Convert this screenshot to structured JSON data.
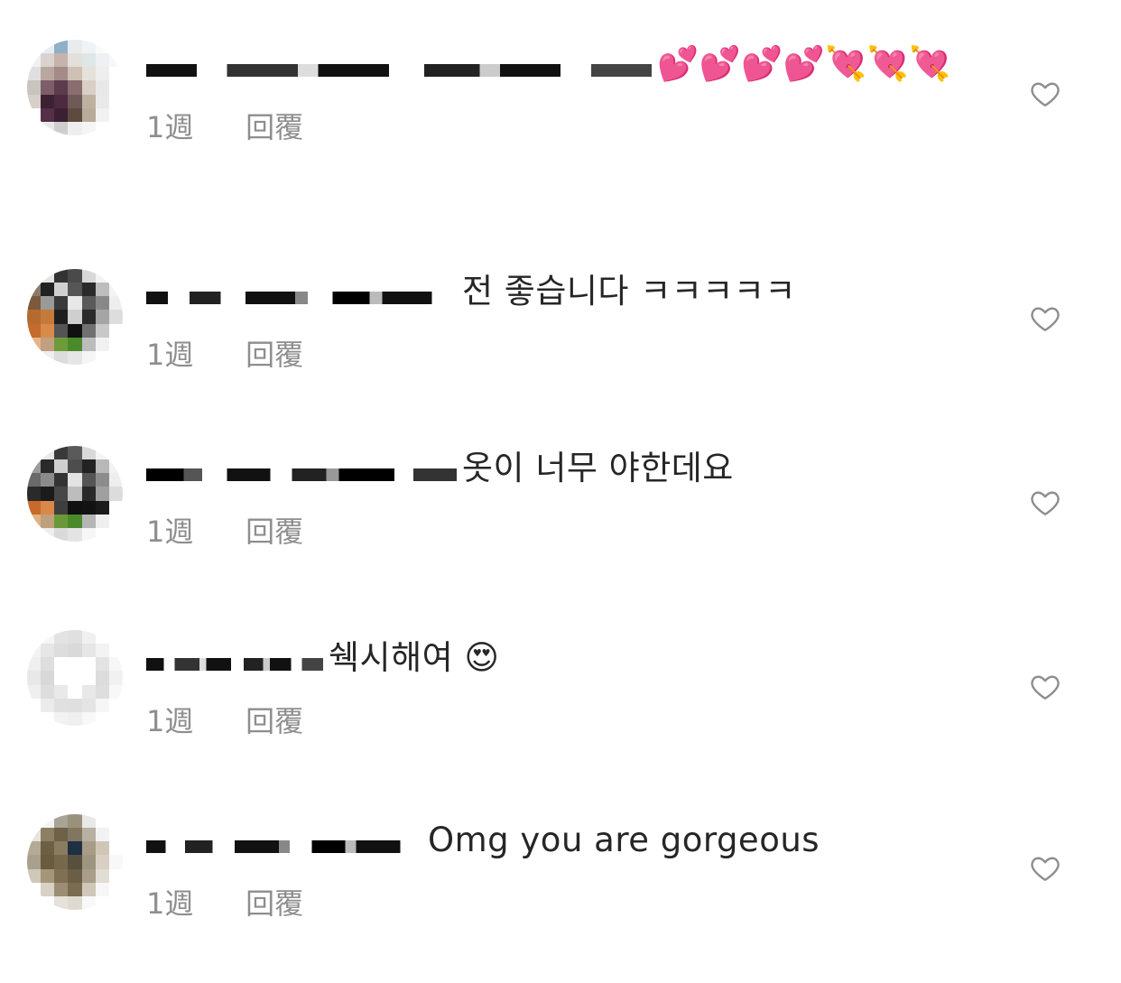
{
  "comments": [
    {
      "text": "💕💕💕💕💘💘💘",
      "time": "1週",
      "reply": "回覆"
    },
    {
      "text": "전 좋습니다 ㅋㅋㅋㅋㅋ",
      "time": "1週",
      "reply": "回覆"
    },
    {
      "text": "옷이 너무 야한데요",
      "time": "1週",
      "reply": "回覆"
    },
    {
      "text": "쉑시해여 😍",
      "time": "1週",
      "reply": "回覆"
    },
    {
      "text": "Omg you are gorgeous",
      "time": "1週",
      "reply": "回覆"
    }
  ],
  "icons": {
    "like": "heart-outline-icon"
  },
  "colors": {
    "text": "#262626",
    "meta": "#8e8e8e",
    "heart_stroke": "#8e8e8e"
  }
}
